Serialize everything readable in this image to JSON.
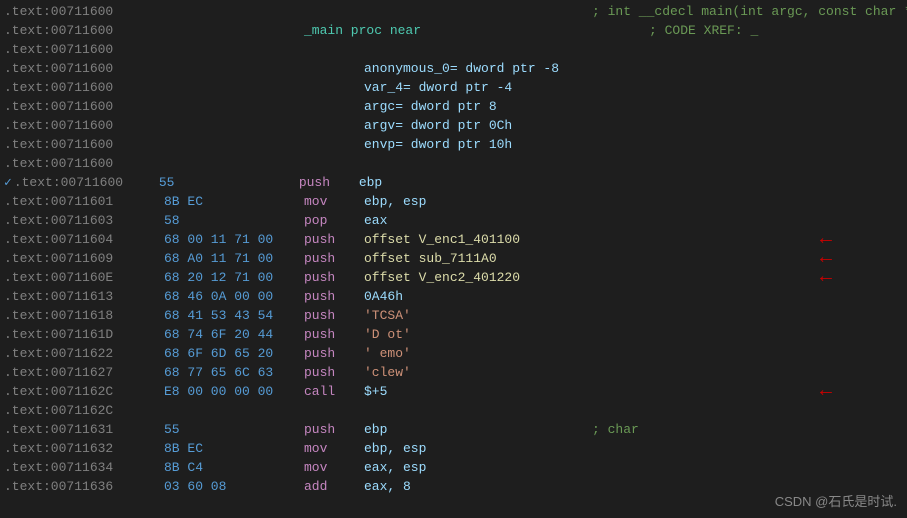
{
  "lines": [
    {
      "addr": ".text:00711600",
      "bytes": "",
      "mnemonic": "",
      "operand": "",
      "comment": "; int __cdecl main(int argc, const char **argv, const",
      "commentColor": "green",
      "arrow": false,
      "hasArrowLeft": false
    },
    {
      "addr": ".text:00711600",
      "bytes": "",
      "mnemonic": "_main proc near",
      "operand": "",
      "comment": "; CODE XREF: _",
      "commentColor": "green",
      "arrow": false,
      "hasArrowLeft": false,
      "mnemonicColor": "cyan"
    },
    {
      "addr": ".text:00711600",
      "bytes": "",
      "mnemonic": "",
      "operand": "",
      "comment": "",
      "arrow": false
    },
    {
      "addr": ".text:00711600",
      "bytes": "",
      "mnemonic": "",
      "operand": "anonymous_0= dword ptr -8",
      "comment": "",
      "arrow": false,
      "operandColor": "cyan"
    },
    {
      "addr": ".text:00711600",
      "bytes": "",
      "mnemonic": "",
      "operand": "var_4= dword ptr -4",
      "comment": "",
      "arrow": false,
      "operandColor": "cyan"
    },
    {
      "addr": ".text:00711600",
      "bytes": "",
      "mnemonic": "",
      "operand": "argc= dword ptr  8",
      "comment": "",
      "arrow": false,
      "operandColor": "cyan"
    },
    {
      "addr": ".text:00711600",
      "bytes": "",
      "mnemonic": "",
      "operand": "argv= dword ptr  0Ch",
      "comment": "",
      "arrow": false,
      "operandColor": "cyan"
    },
    {
      "addr": ".text:00711600",
      "bytes": "",
      "mnemonic": "",
      "operand": "envp= dword ptr  10h",
      "comment": "",
      "arrow": false,
      "operandColor": "cyan"
    },
    {
      "addr": ".text:00711600",
      "bytes": "",
      "mnemonic": "",
      "operand": "",
      "comment": "",
      "arrow": false
    },
    {
      "addr": "✓ .text:00711600",
      "bytes": "55",
      "mnemonic": "push",
      "operand": "ebp",
      "comment": "",
      "arrow": false,
      "hasCheck": true
    },
    {
      "addr": ".text:00711601",
      "bytes": "8B EC",
      "mnemonic": "mov",
      "operand": "ebp, esp",
      "comment": "",
      "arrow": false
    },
    {
      "addr": ".text:00711603",
      "bytes": "58",
      "mnemonic": "pop",
      "operand": "eax",
      "comment": "",
      "arrow": false,
      "hasRedArrow": true
    },
    {
      "addr": ".text:00711604",
      "bytes": "68 00 11 71 00",
      "mnemonic": "push",
      "operand": "offset V_enc1_401100",
      "comment": "",
      "arrow": true,
      "operandColor": "yellow"
    },
    {
      "addr": ".text:00711609",
      "bytes": "68 A0 11 71 00",
      "mnemonic": "push",
      "operand": "offset sub_7111A0",
      "comment": "",
      "arrow": true,
      "operandColor": "yellow"
    },
    {
      "addr": ".text:0071160E",
      "bytes": "68 20 12 71 00",
      "mnemonic": "push",
      "operand": "offset V_enc2_401220",
      "comment": "",
      "arrow": true,
      "operandColor": "yellow"
    },
    {
      "addr": ".text:00711613",
      "bytes": "68 46 0A 00 00",
      "mnemonic": "push",
      "operand": "0A46h",
      "comment": "",
      "arrow": false,
      "operandColor": "cyan"
    },
    {
      "addr": ".text:00711618",
      "bytes": "68 41 53 43 54",
      "mnemonic": "push",
      "operand": "'TCSA'",
      "comment": "",
      "arrow": false,
      "operandColor": "highlight"
    },
    {
      "addr": ".text:0071161D",
      "bytes": "68 74 6F 20 44",
      "mnemonic": "push",
      "operand": "'D ot'",
      "comment": "",
      "arrow": false,
      "operandColor": "highlight"
    },
    {
      "addr": ".text:00711622",
      "bytes": "68 6F 6D 65 20",
      "mnemonic": "push",
      "operand": "' emo'",
      "comment": "",
      "arrow": false,
      "operandColor": "highlight"
    },
    {
      "addr": ".text:00711627",
      "bytes": "68 77 65 6C 63",
      "mnemonic": "push",
      "operand": "'clew'",
      "comment": "",
      "arrow": false,
      "operandColor": "highlight"
    },
    {
      "addr": ".text:0071162C",
      "bytes": "E8 00 00 00 00",
      "mnemonic": "call",
      "operand": "$+5",
      "comment": "",
      "arrow": true,
      "operandColor": "cyan"
    },
    {
      "addr": ".text:0071162C",
      "bytes": "",
      "mnemonic": "",
      "operand": "",
      "comment": "",
      "arrow": false
    },
    {
      "addr": ".text:00711631",
      "bytes": "55",
      "mnemonic": "push",
      "operand": "ebp",
      "comment": "; char",
      "commentColor": "green",
      "arrow": false
    },
    {
      "addr": ".text:00711632",
      "bytes": "8B EC",
      "mnemonic": "mov",
      "operand": "ebp, esp",
      "comment": "",
      "arrow": false
    },
    {
      "addr": ".text:00711634",
      "bytes": "8B C4",
      "mnemonic": "mov",
      "operand": "eax, esp",
      "comment": "",
      "arrow": false
    },
    {
      "addr": ".text:00711636",
      "bytes": "03 60 08",
      "mnemonic": "add",
      "operand": "eax, 8",
      "comment": "",
      "arrow": false
    }
  ],
  "watermark": "CSDN @石氏是时试."
}
